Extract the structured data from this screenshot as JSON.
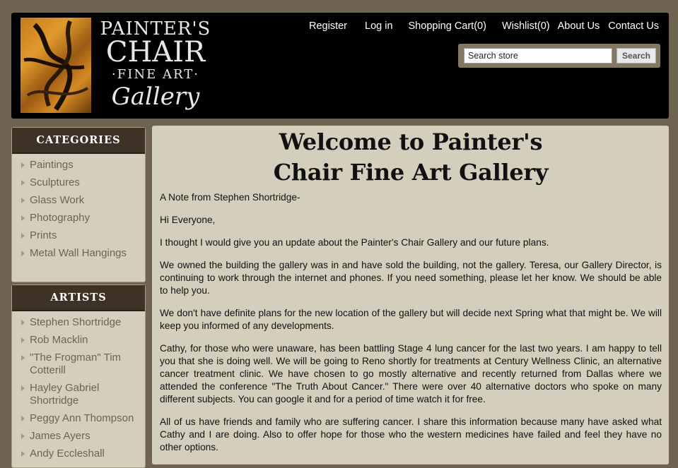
{
  "logo": {
    "line1": "PAINTER'S",
    "line2": "CHAIR",
    "line3": "·FINE ART·",
    "line4": "Gallery"
  },
  "topnav": [
    {
      "label": "Register"
    },
    {
      "label": "Log in"
    },
    {
      "label": "Shopping Cart(0)"
    },
    {
      "label": "Wishlist(0)"
    },
    {
      "label": "About Us"
    },
    {
      "label": "Contact Us"
    }
  ],
  "search": {
    "value": "Search store",
    "button": "Search"
  },
  "categories": {
    "title": "CATEGORIES",
    "items": [
      "Paintings",
      "Sculptures",
      "Glass Work",
      "Photography",
      "Prints",
      "Metal Wall Hangings"
    ]
  },
  "artists": {
    "title": "ARTISTS",
    "items": [
      "Stephen Shortridge",
      "Rob Macklin",
      "\"The Frogman\" Tim Cotterill",
      "Hayley Gabriel Shortridge",
      "Peggy Ann Thompson",
      "James Ayers",
      "Andy Eccleshall"
    ]
  },
  "main": {
    "heading_line1": "Welcome to Painter's",
    "heading_line2": "Chair Fine Art Gallery",
    "paragraphs": [
      "A Note from Stephen Shortridge-",
      "Hi Everyone,",
      "I thought I would give you an update about the Painter's Chair Gallery and our future plans.",
      "We owned the building the gallery was in and have sold the building, not the gallery.  Teresa, our Gallery Director, is continuing to work through the internet and phones.  If you need something, please let her know.  We should be able to help you.",
      "We don't have definite plans for the new location of the gallery but will decide next Spring what that might be.  We will keep you informed of any developments.",
      "Cathy, for those who were unaware, has been battling Stage 4 lung cancer for the last two years.  I am happy to tell you that she is doing well.  We will be going to Reno shortly for treatments at Century Wellness Clinic, an alternative cancer treatment clinic.  We have chosen to go mostly alternative and recently returned from Dallas where we attended the conference \"The Truth About Cancer.\"  There were over 40 alternative doctors who spoke on many different subjects.  You can google it and for a period of time watch it for free.",
      "All of us have friends and family who are suffering cancer.  I share this information because many have asked what Cathy and I are doing.  Also to offer hope for those who the western medicines have failed and feel they have no other options."
    ]
  }
}
